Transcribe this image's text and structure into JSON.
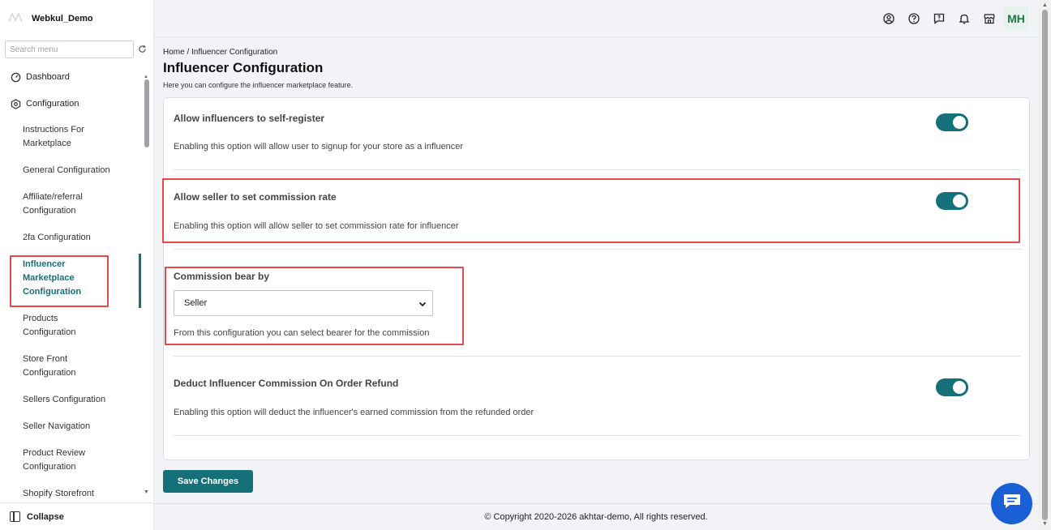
{
  "app": {
    "brand": "Webkul_Demo"
  },
  "sidebar": {
    "search_placeholder": "Search menu",
    "dashboard": "Dashboard",
    "configuration": "Configuration",
    "items": [
      {
        "line1": "Instructions For",
        "line2": "Marketplace"
      },
      {
        "line1": "General Configuration",
        "line2": ""
      },
      {
        "line1": "Affiliate/referral",
        "line2": "Configuration"
      },
      {
        "line1": "2fa Configuration",
        "line2": ""
      },
      {
        "line1": "Influencer",
        "line2": "Marketplace",
        "line3": "Configuration"
      },
      {
        "line1": "Products",
        "line2": "Configuration"
      },
      {
        "line1": "Store Front",
        "line2": "Configuration"
      },
      {
        "line1": "Sellers Configuration",
        "line2": ""
      },
      {
        "line1": "Seller Navigation",
        "line2": ""
      },
      {
        "line1": "Product Review",
        "line2": "Configuration"
      },
      {
        "line1": "Shopify Storefront",
        "line2": ""
      }
    ],
    "collapse": "Collapse"
  },
  "topbar": {
    "avatar_initials": "MH"
  },
  "main": {
    "breadcrumb": "Home / Influencer Configuration",
    "title": "Influencer Configuration",
    "subtitle": "Here you can configure the influencer marketplace feature.",
    "settings": [
      {
        "title": "Allow influencers to self-register",
        "desc": "Enabling this option will allow user to signup for your store as a influencer",
        "enabled": true
      },
      {
        "title": "Allow seller to set commission rate",
        "desc": "Enabling this option will allow seller to set commission rate for influencer",
        "enabled": true
      },
      {
        "title": "Commission bear by",
        "selected": "Seller",
        "desc": "From this configuration you can select bearer for the commission"
      },
      {
        "title": "Deduct Influencer Commission On Order Refund",
        "desc": "Enabling this option will deduct the influencer's earned commission from the refunded order",
        "enabled": true
      }
    ],
    "save_label": "Save Changes"
  },
  "footer": {
    "text": "© Copyright 2020-2026 akhtar-demo, All rights reserved."
  },
  "colors": {
    "accent": "#15707a",
    "highlight": "#e5484d",
    "chat": "#1a5fd6"
  }
}
